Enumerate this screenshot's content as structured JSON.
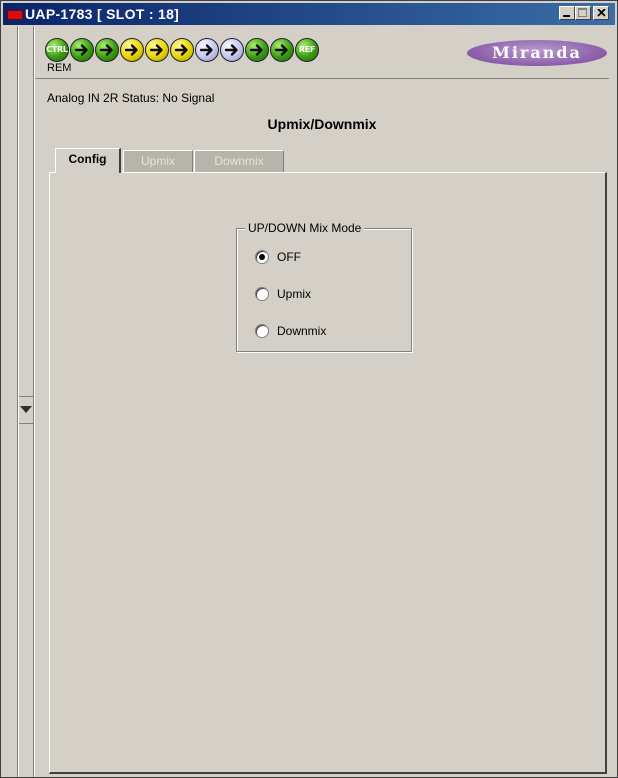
{
  "window": {
    "title": "UAP-1783 [ SLOT : 18]"
  },
  "status_icons": [
    {
      "name": "ctrl",
      "label": "CTRL",
      "color": "green"
    },
    {
      "name": "arrow-1",
      "color": "green"
    },
    {
      "name": "arrow-2",
      "color": "green"
    },
    {
      "name": "arrow-3",
      "color": "yellow"
    },
    {
      "name": "arrow-4",
      "color": "yellow"
    },
    {
      "name": "arrow-5",
      "color": "yellow"
    },
    {
      "name": "arrow-6",
      "color": "lilac"
    },
    {
      "name": "arrow-7",
      "color": "lilac"
    },
    {
      "name": "arrow-8",
      "color": "green"
    },
    {
      "name": "arrow-9",
      "color": "green"
    },
    {
      "name": "ref",
      "label": "REF",
      "color": "green"
    }
  ],
  "rem_label": "REM",
  "logo": {
    "text": "Miranda"
  },
  "status_line": "Analog IN 2R Status: No Signal",
  "panel_title": "Upmix/Downmix",
  "tabs": [
    {
      "label": "Config",
      "active": true
    },
    {
      "label": "Upmix",
      "active": false
    },
    {
      "label": "Downmix",
      "active": false
    }
  ],
  "mix_mode": {
    "group_label": "UP/DOWN Mix Mode",
    "options": [
      {
        "label": "OFF",
        "selected": true
      },
      {
        "label": "Upmix",
        "selected": false
      },
      {
        "label": "Downmix",
        "selected": false
      }
    ]
  },
  "colors": {
    "titlebar_start": "#0a246a",
    "titlebar_end": "#3a6ea5",
    "window_bg": "#d4d0c8",
    "logo": "#8a5ca8"
  }
}
